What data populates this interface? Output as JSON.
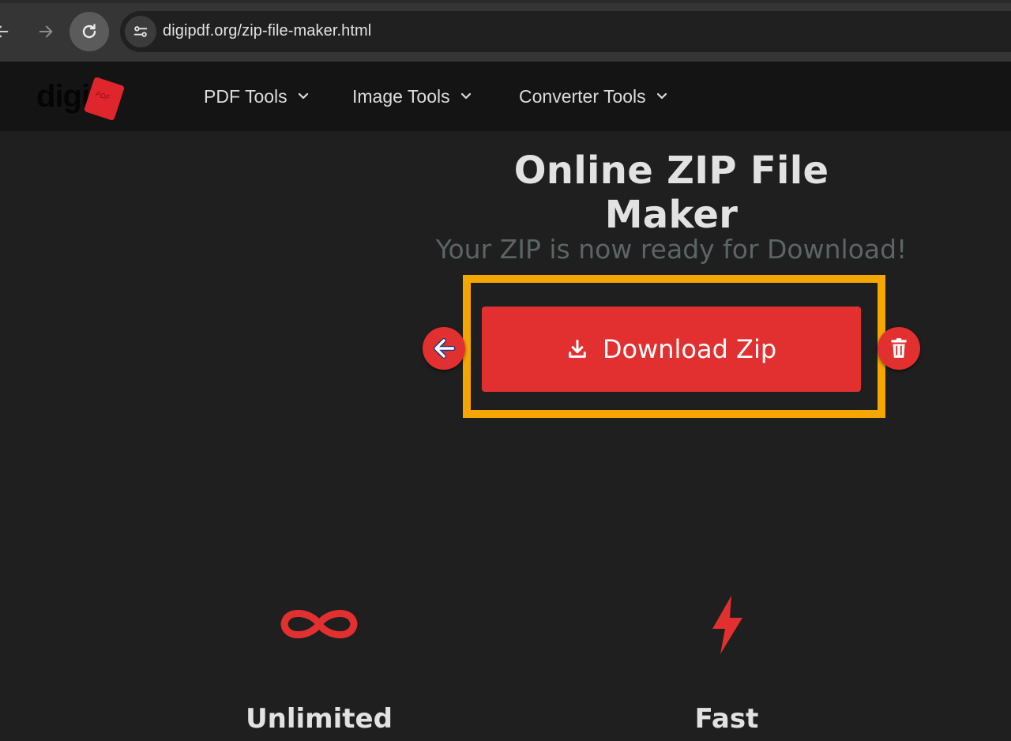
{
  "browser": {
    "url": "digipdf.org/zip-file-maker.html"
  },
  "header": {
    "logo_text": "digi",
    "logo_badge_text": "PDF",
    "menu": [
      {
        "label": "PDF Tools"
      },
      {
        "label": "Image Tools"
      },
      {
        "label": "Converter Tools"
      }
    ]
  },
  "main": {
    "title": "Online ZIP File Maker",
    "ready_message": "Your ZIP is now ready for Download!",
    "download_label": "Download Zip"
  },
  "features": [
    {
      "label": "Unlimited",
      "icon": "infinity-icon"
    },
    {
      "label": "Fast",
      "icon": "lightning-bolt-icon"
    }
  ],
  "colors": {
    "accent_red": "#e23030",
    "highlight_orange": "#f5a700",
    "background": "#1f1f1f",
    "header_bg": "#141414"
  }
}
